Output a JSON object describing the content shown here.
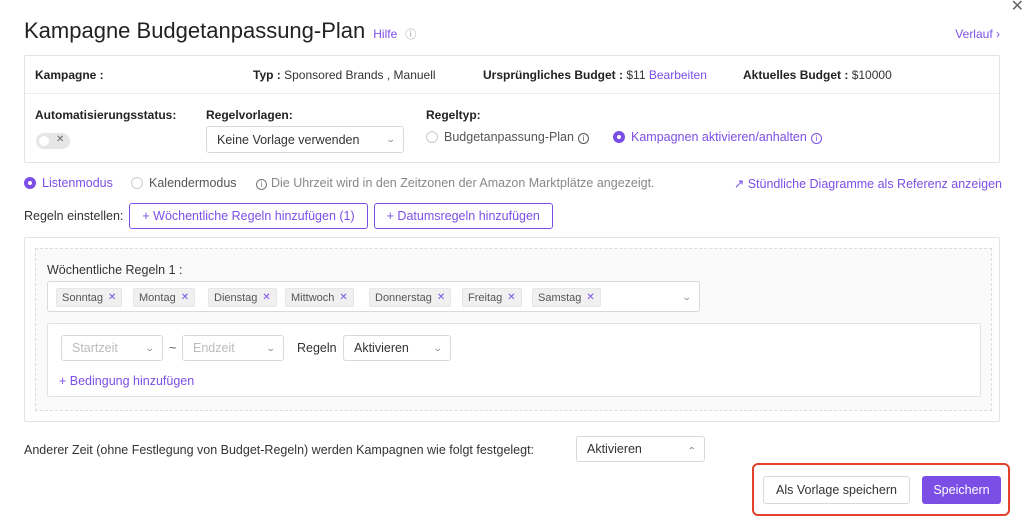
{
  "header": {
    "title": "Kampagne Budgetanpassung-Plan",
    "help": "Hilfe",
    "history": "Verlauf ›",
    "close": "✕"
  },
  "campaign": {
    "campaign_label": "Kampagne :",
    "type_label": "Typ :",
    "type_value": "Sponsored Brands , Manuell",
    "original_budget_label": "Ursprüngliches Budget :",
    "original_budget_value": "$11",
    "edit_link": "Bearbeiten",
    "current_budget_label": "Aktuelles Budget :",
    "current_budget_value": "$10000"
  },
  "automation": {
    "status_label": "Automatisierungsstatus:",
    "toggle_off_glyph": "✕",
    "template_label": "Regelvorlagen:",
    "template_value": "Keine Vorlage verwenden",
    "rule_type_label": "Regeltyp:",
    "rule_type_options": [
      "Budgetanpassung-Plan",
      "Kampagnen aktivieren/anhalten"
    ],
    "rule_type_selected": "Kampagnen aktivieren/anhalten"
  },
  "mode": {
    "list_mode": "Listenmodus",
    "calendar_mode": "Kalendermodus",
    "timezone_note": "Die Uhrzeit wird in den Zeitzonen der Amazon Marktplätze angezeigt.",
    "hourly_chart_link": "Stündliche Diagramme als Referenz anzeigen",
    "selected": "Listenmodus"
  },
  "rules": {
    "label": "Regeln einstellen:",
    "add_weekly": "+ Wöchentliche Regeln hinzufügen (1)",
    "add_date": "+ Datumsregeln hinzufügen",
    "weekly_title": "Wöchentliche Regeln 1 :",
    "days": [
      "Sonntag",
      "Montag",
      "Dienstag",
      "Mittwoch",
      "Donnerstag",
      "Freitag",
      "Samstag"
    ],
    "start_placeholder": "Startzeit",
    "end_placeholder": "Endzeit",
    "tilde": "~",
    "rule_label": "Regeln",
    "rule_value": "Aktivieren",
    "add_condition": "+ Bedingung hinzufügen"
  },
  "other": {
    "label": "Anderer Zeit (ohne Festlegung von Budget-Regeln) werden Kampagnen wie folgt festgelegt:",
    "value": "Aktivieren"
  },
  "footer": {
    "save_template": "Als Vorlage speichern",
    "save": "Speichern"
  },
  "colors": {
    "accent": "#7b4fe6",
    "highlight": "#e2412a"
  }
}
